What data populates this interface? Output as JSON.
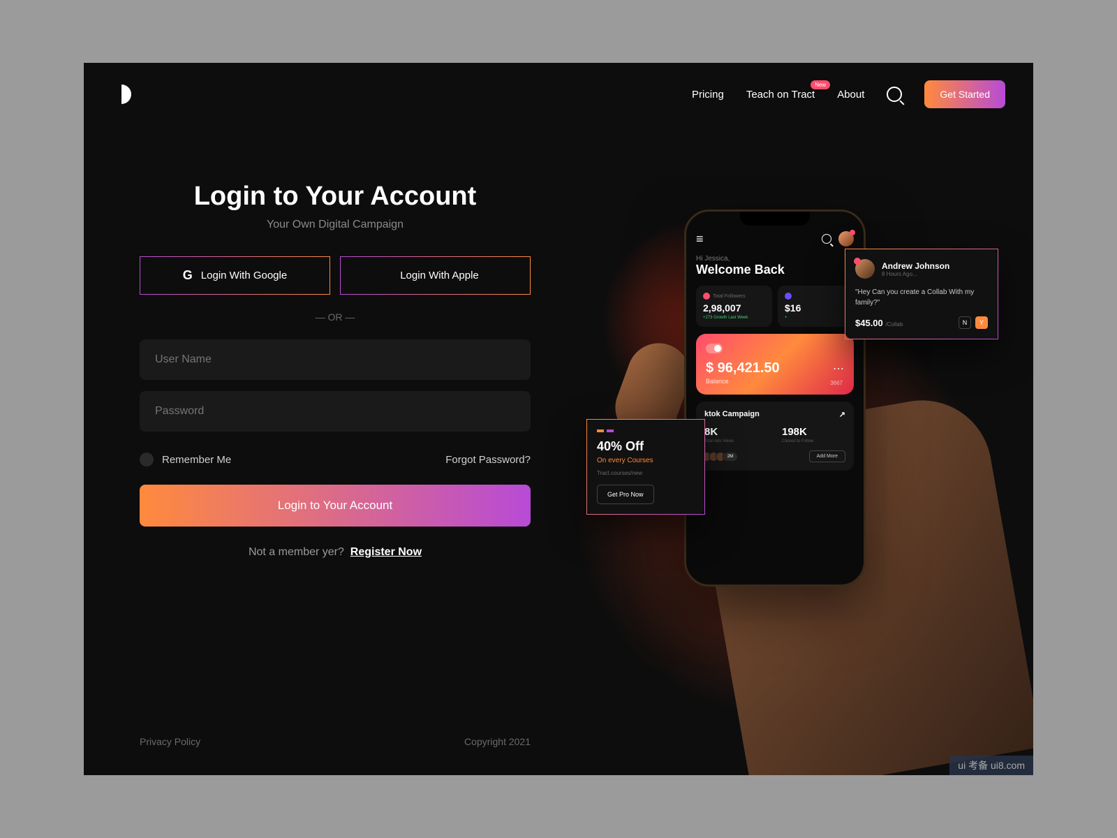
{
  "header": {
    "nav": {
      "pricing": "Pricing",
      "teach": "Teach on Tract",
      "badge": "New",
      "about": "About"
    },
    "cta": "Get Started"
  },
  "login": {
    "title": "Login to Your Account",
    "subtitle": "Your Own Digital Campaign",
    "google": "Login With Google",
    "apple": "Login With Apple",
    "or": "— OR —",
    "username_ph": "User Name",
    "password_ph": "Password",
    "remember": "Remember Me",
    "forgot": "Forgot Password?",
    "submit": "Login to Your Account",
    "register_prompt": "Not a member yer?",
    "register_link": "Register Now"
  },
  "footer": {
    "privacy": "Privacy Policy",
    "copyright": "Copyright 2021"
  },
  "mock": {
    "greet": "Hi Jessica,",
    "welcome": "Welcome Back",
    "stat1": {
      "label": "Total Followers",
      "value": "2,98,007",
      "growth": "+273   Growth Last Week"
    },
    "stat2": {
      "value": "$16"
    },
    "balance": {
      "amount": "$ 96,421.50",
      "label": "Balance",
      "last4": "3667"
    },
    "campaign": {
      "title": "ktok Campaign",
      "v1": "8K",
      "l1": "Total Ads Views",
      "v2": "198K",
      "l2": "Clicked to Follow",
      "more_count": "2M",
      "add_more": "Add More"
    },
    "msg": {
      "name": "Andrew Johnson",
      "time": "8 Hours Ago...",
      "body": "\"Hey Can you create a Collab With my family?\"",
      "price": "$45.00",
      "price_unit": "/Collab",
      "n": "N",
      "y": "Y"
    },
    "promo": {
      "title": "40% Off",
      "sub": "On every Courses",
      "link": "Tract.courses/new",
      "btn": "Get Pro Now"
    }
  },
  "watermark": "ui 考备\nui8.com"
}
